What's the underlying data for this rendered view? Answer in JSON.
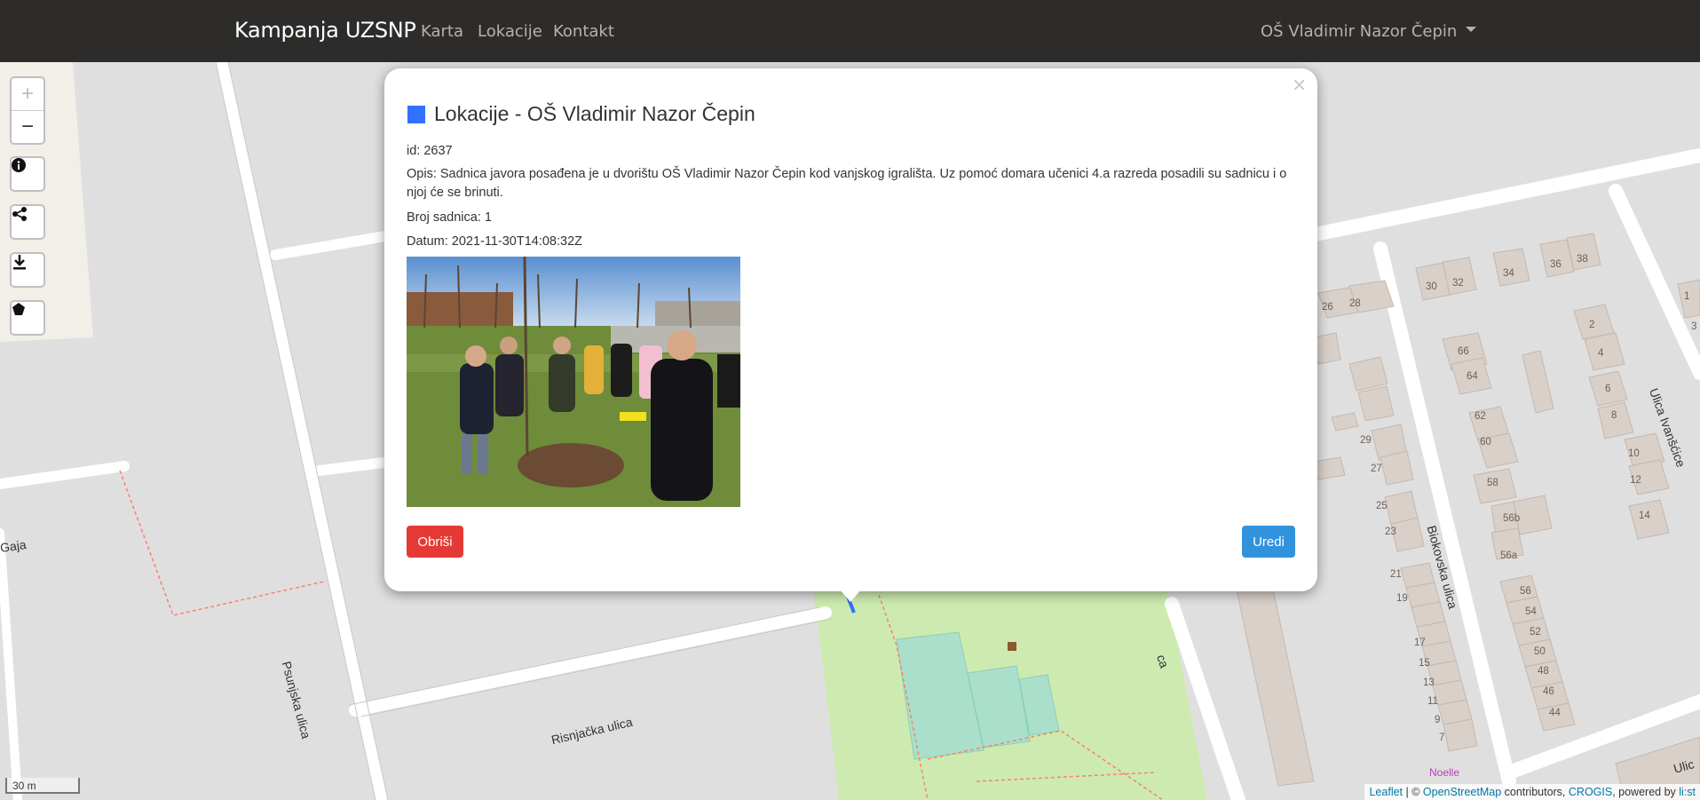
{
  "navbar": {
    "brand": "Kampanja UZSNP",
    "links": [
      "Karta",
      "Lokacije",
      "Kontakt"
    ],
    "user": "OŠ Vladimir Nazor Čepin"
  },
  "map": {
    "labels": {
      "gaja": "Gaja",
      "psunjska": "Psunjska ulica",
      "risnjacka": "Risnjačka ulica",
      "biokovska": "Biokovska ulica",
      "ivanscice": "Ulica Ivanšćice",
      "noelle": "Noelle",
      "ulica": "Ulic",
      "street_ca": "ca"
    },
    "house_numbers": [
      "26",
      "28",
      "30",
      "32",
      "34",
      "36",
      "38",
      "1",
      "2",
      "3",
      "4",
      "6",
      "8",
      "10",
      "12",
      "14",
      "66",
      "64",
      "62",
      "60",
      "58",
      "56b",
      "56a",
      "56",
      "54",
      "52",
      "50",
      "48",
      "46",
      "44",
      "29",
      "27",
      "25",
      "23",
      "21",
      "19",
      "17",
      "15",
      "13",
      "11",
      "9",
      "7",
      "1"
    ],
    "scale": "30 m",
    "attribution": {
      "leaflet": "Leaflet",
      "sep": " | © ",
      "osm": "OpenStreetMap",
      "contrib": " contributors, ",
      "crogis": "CROGIS",
      "powered": ", powered by ",
      "list": "li:st"
    },
    "controls": {
      "zoom_in": "+",
      "zoom_out": "−"
    }
  },
  "popup": {
    "close": "×",
    "title": "Lokacije - OŠ Vladimir Nazor Čepin",
    "swatch_color": "#3270ff",
    "id_line": "id: 2637",
    "opis_line": "Opis: Sadnica javora posađena je u dvorištu OŠ Vladimir Nazor Čepin kod vanjskog igrališta. Uz pomoć domara učenici 4.a razreda posadili su sadnicu i o njoj će se brinuti.",
    "broj_line": "Broj sadnica: 1",
    "datum_line": "Datum: 2021-11-30T14:08:32Z",
    "delete_label": "Obriši",
    "edit_label": "Uredi"
  },
  "colors": {
    "navbar": "#2d2c2a",
    "delete": "#e53935",
    "edit": "#3293dd",
    "park": "#cdebb0",
    "pitch": "#aae0cb",
    "building": "#d9d0c9"
  }
}
